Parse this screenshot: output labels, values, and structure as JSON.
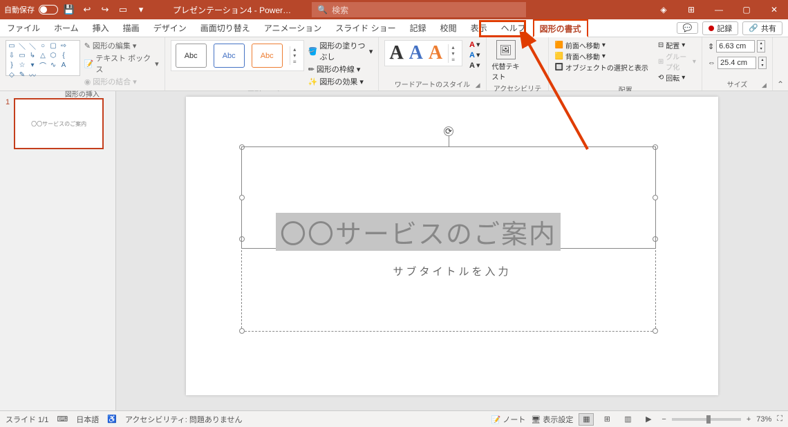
{
  "titlebar": {
    "autosave_label": "自動保存",
    "autosave_state": "オフ",
    "doc_title": "プレゼンテーション4 - Power…",
    "search_placeholder": "検索"
  },
  "tabs": {
    "file": "ファイル",
    "home": "ホーム",
    "insert": "挿入",
    "draw": "描画",
    "design": "デザイン",
    "transitions": "画面切り替え",
    "animations": "アニメーション",
    "slideshow": "スライド ショー",
    "record": "記録",
    "review": "校閲",
    "view": "表示",
    "help": "ヘルプ",
    "shape_format": "図形の書式",
    "comments_btn": "",
    "record_btn": "記録",
    "share_btn": "共有"
  },
  "ribbon": {
    "group_shapes_label": "図形の挿入",
    "edit_shape": "図形の編集",
    "text_box": "テキスト ボックス",
    "merge_shapes": "図形の結合",
    "group_styles_label": "図形のスタイル",
    "style_abc": "Abc",
    "shape_fill": "図形の塗りつぶし",
    "shape_outline": "図形の枠線",
    "shape_effects": "図形の効果",
    "group_wordart_label": "ワードアートのスタイル",
    "wa_letter": "A",
    "text_fill_icon": "A",
    "text_outline_icon": "A",
    "text_effects_icon": "A",
    "group_acc_label": "アクセシビリティ",
    "alt_text": "代替テキスト",
    "group_arrange_label": "配置",
    "bring_forward": "前面へ移動",
    "send_backward": "背面へ移動",
    "selection_pane": "オブジェクトの選択と表示",
    "align": "配置",
    "group_cmd": "グループ化",
    "rotate": "回転",
    "group_size_label": "サイズ",
    "height_val": "6.63 cm",
    "width_val": "25.4 cm"
  },
  "thumb": {
    "num": "1",
    "title": "〇〇サービスのご案内"
  },
  "slide": {
    "title": "〇〇サービスのご案内",
    "subtitle": "サブタイトルを入力"
  },
  "status": {
    "slide_count": "スライド 1/1",
    "language": "日本語",
    "accessibility": "アクセシビリティ: 問題ありません",
    "notes": "ノート",
    "display_settings": "表示設定",
    "zoom": "73%"
  }
}
